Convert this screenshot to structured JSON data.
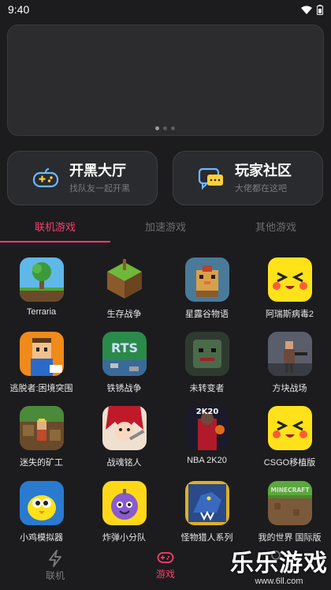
{
  "status": {
    "time": "9:40"
  },
  "cards": [
    {
      "title": "开黑大厅",
      "subtitle": "找队友一起开黑",
      "icon": "gamepad-icon"
    },
    {
      "title": "玩家社区",
      "subtitle": "大佬都在这吧",
      "icon": "chat-icon"
    }
  ],
  "tabs": [
    {
      "label": "联机游戏",
      "active": true
    },
    {
      "label": "加速游戏",
      "active": false
    },
    {
      "label": "其他游戏",
      "active": false
    }
  ],
  "games": [
    {
      "name": "Terraria",
      "icon": "terraria-icon"
    },
    {
      "name": "生存战争",
      "icon": "survivalcraft-icon"
    },
    {
      "name": "星露谷物语",
      "icon": "stardew-icon"
    },
    {
      "name": "阿瑞斯病毒2",
      "icon": "ares-virus-icon"
    },
    {
      "name": "逃脱者:困境突围",
      "icon": "escapists-icon"
    },
    {
      "name": "铁锈战争",
      "icon": "rusted-warfare-icon"
    },
    {
      "name": "未转变者",
      "icon": "unturned-icon"
    },
    {
      "name": "方块战场",
      "icon": "block-battlefield-icon"
    },
    {
      "name": "迷失的矿工",
      "icon": "lost-miner-icon"
    },
    {
      "name": "战魂铭人",
      "icon": "soul-knight-icon"
    },
    {
      "name": "NBA 2K20",
      "icon": "nba2k20-icon"
    },
    {
      "name": "CSGO移植版",
      "icon": "csgo-icon"
    },
    {
      "name": "小鸡模拟器",
      "icon": "chicken-emulator-icon"
    },
    {
      "name": "炸弹小分队",
      "icon": "bomb-squad-icon"
    },
    {
      "name": "怪物猎人系列",
      "icon": "monster-hunter-icon"
    },
    {
      "name": "我的世界 国际版",
      "icon": "minecraft-icon"
    }
  ],
  "nav": [
    {
      "label": "联机",
      "icon": "lightning-icon",
      "active": false
    },
    {
      "label": "游戏",
      "icon": "gamepad-icon",
      "active": true
    },
    {
      "label": "",
      "icon": "profile-icon",
      "active": false
    }
  ],
  "watermark": {
    "main": "乐乐游戏",
    "url": "www.6ll.com"
  },
  "colors": {
    "accent": "#ff3d6e",
    "background": "#1c1c1e",
    "card": "#2a2b2f"
  }
}
